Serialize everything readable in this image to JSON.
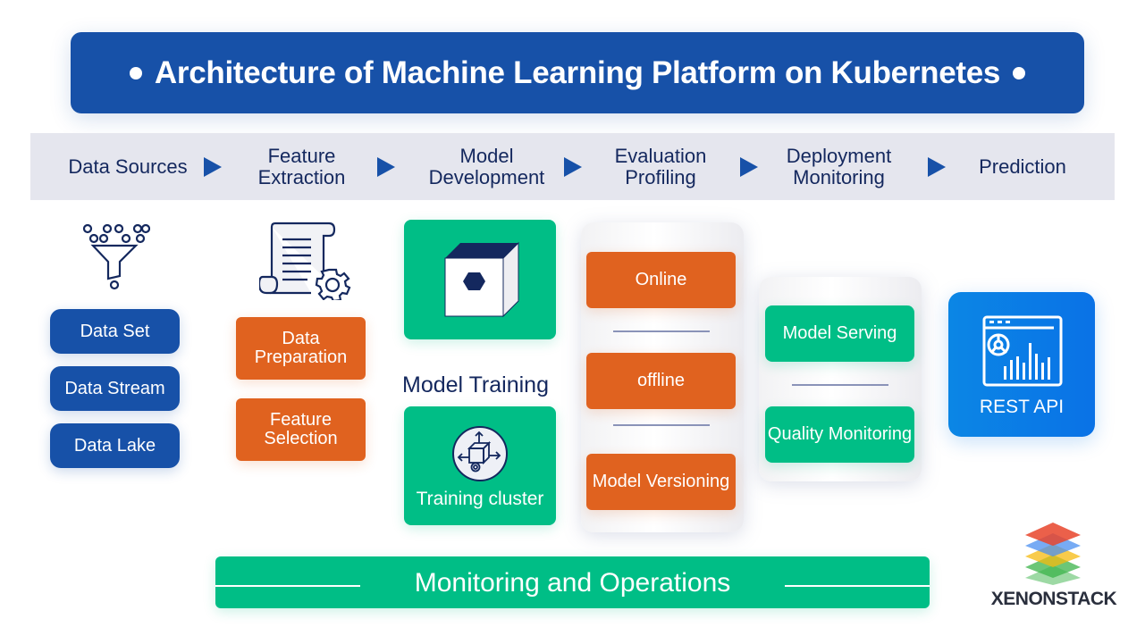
{
  "title": "Architecture of Machine Learning Platform on Kubernetes",
  "pipeline": {
    "stages": [
      {
        "label": "Data Sources"
      },
      {
        "label": "Feature Extraction"
      },
      {
        "label": "Model Development"
      },
      {
        "label": "Evaluation Profiling"
      },
      {
        "label": "Deployment Monitoring"
      },
      {
        "label": "Prediction"
      }
    ]
  },
  "data_sources": {
    "icon": "funnel-icon",
    "items": [
      "Data Set",
      "Data Stream",
      "Data Lake"
    ]
  },
  "feature_extraction": {
    "icon": "document-gear-icon",
    "items": [
      "Data Preparation",
      "Feature Selection"
    ]
  },
  "model_development": {
    "icon": "cube-icon",
    "label": "Model Training",
    "cluster_label": "Training cluster",
    "cluster_icon": "cluster-cube-icon"
  },
  "evaluation": {
    "items": [
      "Online",
      "offline",
      "Model Versioning"
    ]
  },
  "deployment": {
    "items": [
      "Model Serving",
      "Quality Monitoring"
    ]
  },
  "prediction": {
    "icon": "dashboard-icon",
    "label": "REST API"
  },
  "footer": {
    "label": "Monitoring and Operations"
  },
  "brand": {
    "name": "XENONSTACK",
    "colors": [
      "#e8442a",
      "#4a8ff0",
      "#f5b90f",
      "#3bb34a"
    ]
  },
  "colors": {
    "primary_blue": "#1751a8",
    "orange": "#e0621f",
    "green": "#00be86",
    "rest_blue": "#0b78e3",
    "text_dark": "#14285e"
  }
}
